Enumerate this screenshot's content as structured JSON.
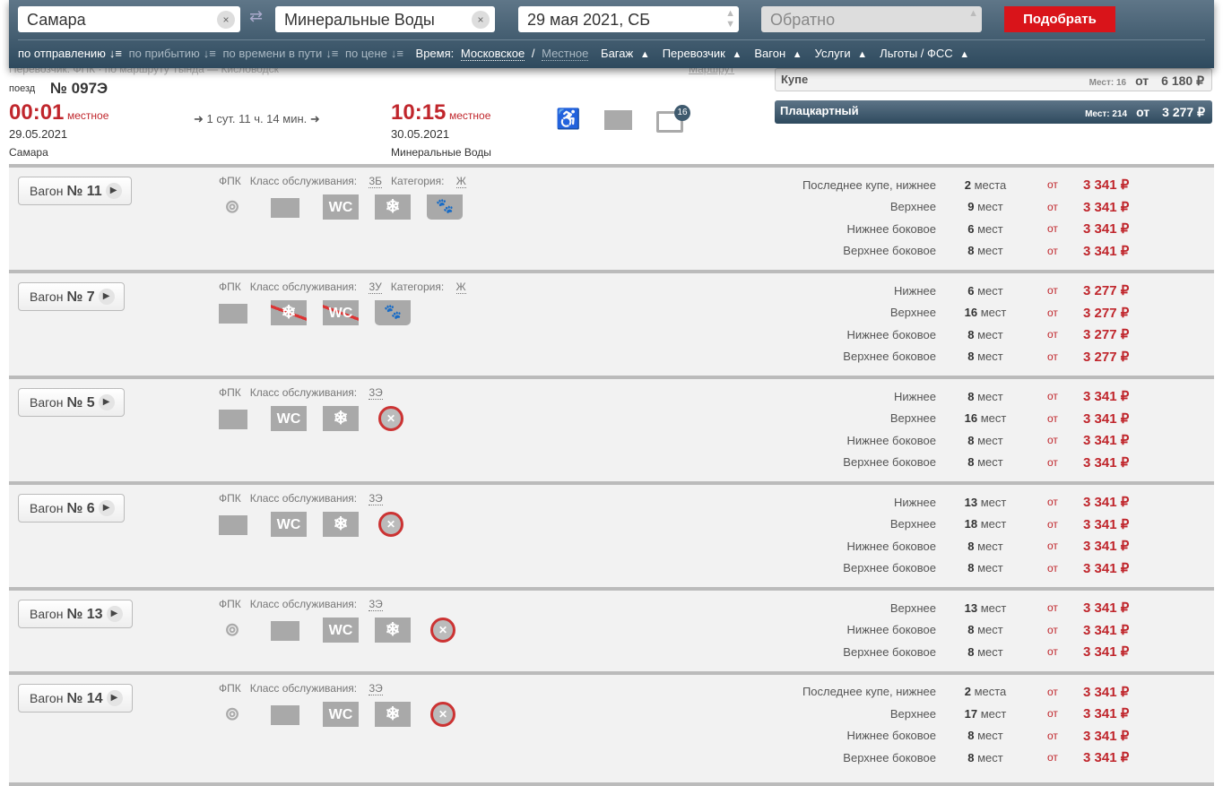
{
  "search": {
    "from": "Самара",
    "to": "Минеральные Воды",
    "date": "29 мая 2021, СБ",
    "return_placeholder": "Обратно",
    "submit": "Подобрать",
    "clear": "×",
    "swap": "⇄"
  },
  "filters": {
    "sort": [
      "по отправлению",
      "по прибытию",
      "по времени в пути",
      "по цене"
    ],
    "sort_icon": "↓≡",
    "time_label": "Время:",
    "time_moscow": "Московское",
    "sep": "/",
    "time_local": "Местное",
    "dropdowns": [
      "Багаж",
      "Перевозчик",
      "Вагон",
      "Услуги",
      "Льготы / ФСС"
    ],
    "caret": "▲"
  },
  "train": {
    "ghost_line": "Перевозчик: ФПК · по маршруту Тында — Кисловодск",
    "route_link": "Маршрут",
    "label": "поезд",
    "number": "№ 097Э",
    "dep_time": "00:01",
    "dep_note": "местное",
    "dep_date": "29.05.2021",
    "dep_station": "Самара",
    "duration": "➜ 1 сут. 11 ч. 14 мин. ➜",
    "arr_time": "10:15",
    "arr_note": "местное",
    "arr_date": "30.05.2021",
    "arr_station": "Минеральные Воды",
    "luggage_badge": "16",
    "icons": [
      "wheelchair-icon",
      "baggage-icon",
      "luggage-icon"
    ]
  },
  "fares": [
    {
      "name": "Купе",
      "seats": "Мест: 16",
      "from": "от",
      "price": "6 180 ₽"
    },
    {
      "name": "Плацкартный",
      "seats": "Мест: 214",
      "from": "от",
      "price": "3 277 ₽"
    }
  ],
  "colors": {
    "accent": "#c0262c",
    "header": "#2e4a5e",
    "button": "#d9141a"
  },
  "car_label": "Вагон",
  "cars": [
    {
      "num": "№ 11",
      "carrier": "ФПК",
      "class_label": "Класс обслуживания:",
      "class": "3Б",
      "cat_label": "Категория:",
      "cat": "Ж",
      "icons": [
        "food",
        "bag",
        "wc",
        "snow",
        "pets"
      ],
      "seats": [
        {
          "type": "Последнее купе, нижнее",
          "count": "2",
          "unit": "места",
          "from": "от",
          "price": "3 341 ₽"
        },
        {
          "type": "Верхнее",
          "count": "9",
          "unit": "мест",
          "from": "от",
          "price": "3 341 ₽"
        },
        {
          "type": "Нижнее боковое",
          "count": "6",
          "unit": "мест",
          "from": "от",
          "price": "3 341 ₽"
        },
        {
          "type": "Верхнее боковое",
          "count": "8",
          "unit": "мест",
          "from": "от",
          "price": "3 341 ₽"
        }
      ]
    },
    {
      "num": "№ 7",
      "carrier": "ФПК",
      "class_label": "Класс обслуживания:",
      "class": "3У",
      "cat_label": "Категория:",
      "cat": "Ж",
      "icons": [
        "bag",
        "snow-off",
        "wc-off",
        "pets"
      ],
      "seats": [
        {
          "type": "Нижнее",
          "count": "6",
          "unit": "мест",
          "from": "от",
          "price": "3 277 ₽"
        },
        {
          "type": "Верхнее",
          "count": "16",
          "unit": "мест",
          "from": "от",
          "price": "3 277 ₽"
        },
        {
          "type": "Нижнее боковое",
          "count": "8",
          "unit": "мест",
          "from": "от",
          "price": "3 277 ₽"
        },
        {
          "type": "Верхнее боковое",
          "count": "8",
          "unit": "мест",
          "from": "от",
          "price": "3 277 ₽"
        }
      ]
    },
    {
      "num": "№ 5",
      "carrier": "ФПК",
      "class_label": "Класс обслуживания:",
      "class": "3Э",
      "icons": [
        "bag",
        "wc",
        "snow",
        "no-pets"
      ],
      "seats": [
        {
          "type": "Нижнее",
          "count": "8",
          "unit": "мест",
          "from": "от",
          "price": "3 341 ₽"
        },
        {
          "type": "Верхнее",
          "count": "16",
          "unit": "мест",
          "from": "от",
          "price": "3 341 ₽"
        },
        {
          "type": "Нижнее боковое",
          "count": "8",
          "unit": "мест",
          "from": "от",
          "price": "3 341 ₽"
        },
        {
          "type": "Верхнее боковое",
          "count": "8",
          "unit": "мест",
          "from": "от",
          "price": "3 341 ₽"
        }
      ]
    },
    {
      "num": "№ 6",
      "carrier": "ФПК",
      "class_label": "Класс обслуживания:",
      "class": "3Э",
      "icons": [
        "bag",
        "wc",
        "snow",
        "no-pets"
      ],
      "seats": [
        {
          "type": "Нижнее",
          "count": "13",
          "unit": "мест",
          "from": "от",
          "price": "3 341 ₽"
        },
        {
          "type": "Верхнее",
          "count": "18",
          "unit": "мест",
          "from": "от",
          "price": "3 341 ₽"
        },
        {
          "type": "Нижнее боковое",
          "count": "8",
          "unit": "мест",
          "from": "от",
          "price": "3 341 ₽"
        },
        {
          "type": "Верхнее боковое",
          "count": "8",
          "unit": "мест",
          "from": "от",
          "price": "3 341 ₽"
        }
      ]
    },
    {
      "num": "№ 13",
      "carrier": "ФПК",
      "class_label": "Класс обслуживания:",
      "class": "3Э",
      "icons": [
        "food",
        "bag",
        "wc",
        "snow",
        "no-pets"
      ],
      "seats": [
        {
          "type": "Верхнее",
          "count": "13",
          "unit": "мест",
          "from": "от",
          "price": "3 341 ₽"
        },
        {
          "type": "Нижнее боковое",
          "count": "8",
          "unit": "мест",
          "from": "от",
          "price": "3 341 ₽"
        },
        {
          "type": "Верхнее боковое",
          "count": "8",
          "unit": "мест",
          "from": "от",
          "price": "3 341 ₽"
        }
      ]
    },
    {
      "num": "№ 14",
      "carrier": "ФПК",
      "class_label": "Класс обслуживания:",
      "class": "3Э",
      "icons": [
        "food",
        "bag",
        "wc",
        "snow",
        "no-pets"
      ],
      "seats": [
        {
          "type": "Последнее купе, нижнее",
          "count": "2",
          "unit": "места",
          "from": "от",
          "price": "3 341 ₽"
        },
        {
          "type": "Верхнее",
          "count": "17",
          "unit": "мест",
          "from": "от",
          "price": "3 341 ₽"
        },
        {
          "type": "Нижнее боковое",
          "count": "8",
          "unit": "мест",
          "from": "от",
          "price": "3 341 ₽"
        },
        {
          "type": "Верхнее боковое",
          "count": "8",
          "unit": "мест",
          "from": "от",
          "price": "3 341 ₽"
        }
      ]
    }
  ]
}
